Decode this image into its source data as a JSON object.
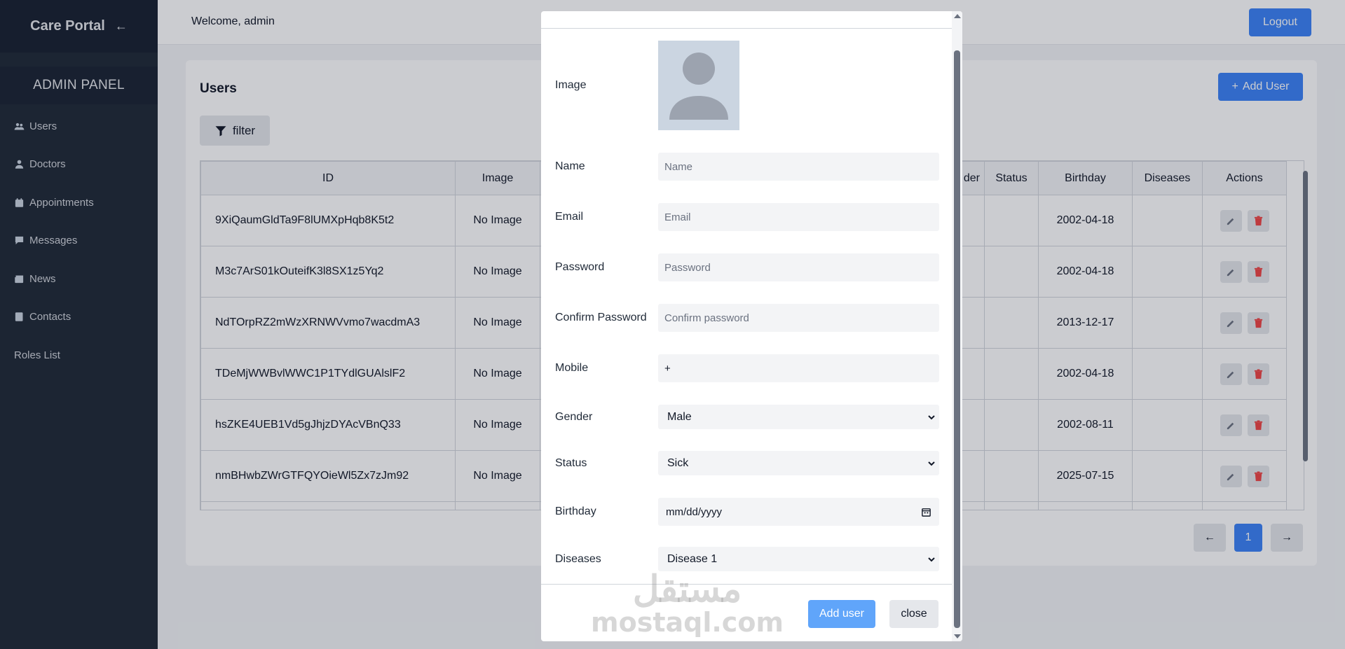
{
  "sidebar": {
    "brand": "Care Portal",
    "back_icon": "←",
    "panel_title": "ADMIN PANEL",
    "items": [
      {
        "label": "Users",
        "icon": "users-icon"
      },
      {
        "label": "Doctors",
        "icon": "doctor-icon"
      },
      {
        "label": "Appointments",
        "icon": "calendar-icon"
      },
      {
        "label": "Messages",
        "icon": "message-icon"
      },
      {
        "label": "News",
        "icon": "newspaper-icon"
      },
      {
        "label": "Contacts",
        "icon": "contact-card-icon"
      },
      {
        "label": "Roles List",
        "icon": ""
      }
    ]
  },
  "topbar": {
    "welcome": "Welcome, admin",
    "logout": "Logout"
  },
  "page": {
    "title": "Users",
    "add_user": "Add User",
    "filter": "filter"
  },
  "table": {
    "headers": [
      "ID",
      "Image",
      "der",
      "Status",
      "Birthday",
      "Diseases",
      "Actions"
    ],
    "rows": [
      {
        "id": "9XiQaumGldTa9F8lUMXpHqb8K5t2",
        "image": "No Image",
        "birthday": "2002-04-18"
      },
      {
        "id": "M3c7ArS01kOuteifK3l8SX1z5Yq2",
        "image": "No Image",
        "birthday": "2002-04-18"
      },
      {
        "id": "NdTOrpRZ2mWzXRNWVvmo7wacdmA3",
        "image": "No Image",
        "birthday": "2013-12-17"
      },
      {
        "id": "TDeMjWWBvlWWC1P1TYdlGUAlslF2",
        "image": "No Image",
        "birthday": "2002-04-18"
      },
      {
        "id": "hsZKE4UEB1Vd5gJhjzDYAcVBnQ33",
        "image": "No Image",
        "birthday": "2002-08-11"
      },
      {
        "id": "nmBHwbZWrGTFQYOieWl5Zx7zJm92",
        "image": "No Image",
        "birthday": "2025-07-15"
      }
    ]
  },
  "pagination": {
    "prev": "←",
    "current": "1",
    "next": "→"
  },
  "modal": {
    "image_label": "Image",
    "name_label": "Name",
    "name_placeholder": "Name",
    "email_label": "Email",
    "email_placeholder": "Email",
    "password_label": "Password",
    "password_placeholder": "Password",
    "confirm_label": "Confirm Password",
    "confirm_placeholder": "Confirm password",
    "mobile_label": "Mobile",
    "mobile_value": "+",
    "gender_label": "Gender",
    "gender_value": "Male",
    "status_label": "Status",
    "status_value": "Sick",
    "birthday_label": "Birthday",
    "birthday_value": "mm/dd/yyyy",
    "diseases_label": "Diseases",
    "diseases_value": "Disease 1",
    "add_button": "Add user",
    "close_button": "close"
  },
  "watermark": {
    "arabic": "مستقل",
    "latin": "mostaql.com"
  },
  "colors": {
    "sidebar_bg": "#1f2937",
    "primary": "#3b82f6",
    "danger": "#ef4444"
  }
}
